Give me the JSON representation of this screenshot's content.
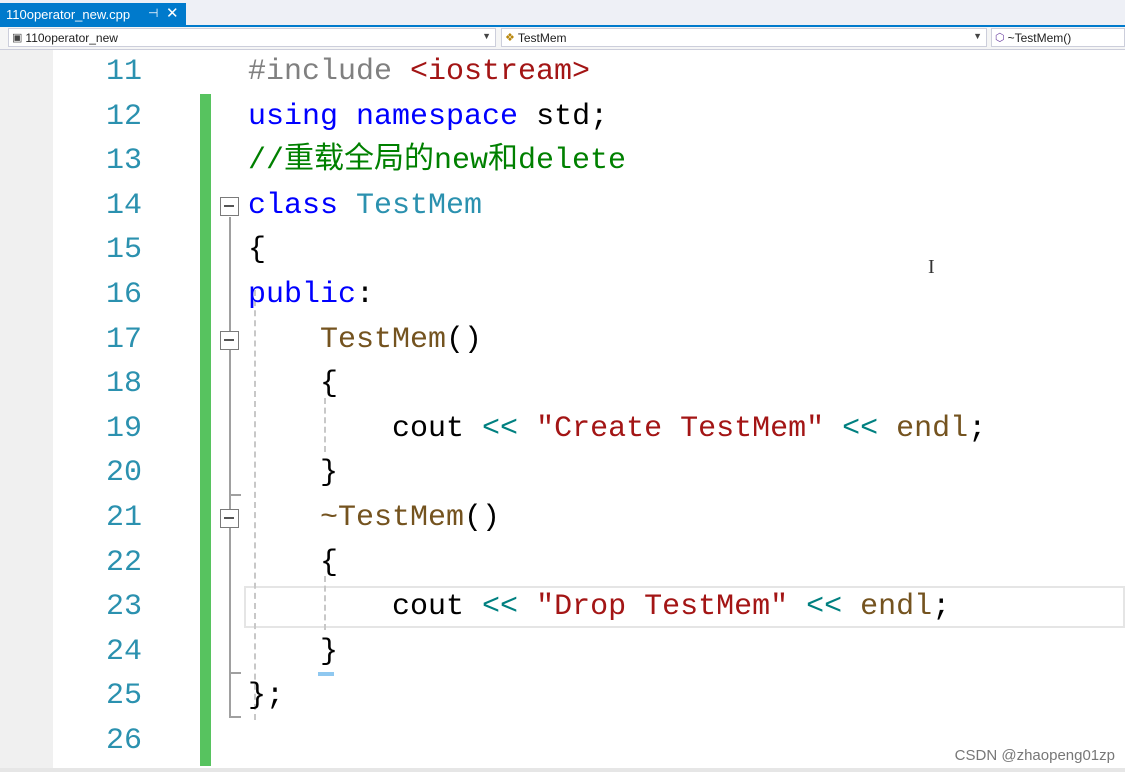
{
  "tab": {
    "filename": "110operator_new.cpp",
    "pin_glyph": "⊣",
    "close_glyph": "✕"
  },
  "navbar": {
    "project": "110operator_new",
    "class_scope": "TestMem",
    "member": "~TestMem()"
  },
  "editor": {
    "lines": [
      {
        "num": "11",
        "tokens": [
          {
            "t": "#include ",
            "c": "pp"
          },
          {
            "t": "<iostream>",
            "c": "st"
          }
        ]
      },
      {
        "num": "12",
        "tokens": [
          {
            "t": "using",
            "c": "kw"
          },
          {
            "t": " ",
            "c": ""
          },
          {
            "t": "namespace",
            "c": "kw"
          },
          {
            "t": " std;",
            "c": ""
          }
        ]
      },
      {
        "num": "13",
        "tokens": [
          {
            "t": "//重载全局的new和delete",
            "c": "cm"
          }
        ]
      },
      {
        "num": "14",
        "tokens": [
          {
            "t": "class",
            "c": "kw"
          },
          {
            "t": " ",
            "c": ""
          },
          {
            "t": "TestMem",
            "c": "ty"
          }
        ]
      },
      {
        "num": "15",
        "tokens": [
          {
            "t": "{",
            "c": ""
          }
        ]
      },
      {
        "num": "16",
        "tokens": [
          {
            "t": "public",
            "c": "kw"
          },
          {
            "t": ":",
            "c": ""
          }
        ]
      },
      {
        "num": "17",
        "tokens": [
          {
            "t": "    ",
            "c": ""
          },
          {
            "t": "TestMem",
            "c": "fn"
          },
          {
            "t": "()",
            "c": ""
          }
        ]
      },
      {
        "num": "18",
        "tokens": [
          {
            "t": "    {",
            "c": ""
          }
        ]
      },
      {
        "num": "19",
        "tokens": [
          {
            "t": "        cout ",
            "c": ""
          },
          {
            "t": "<<",
            "c": "op"
          },
          {
            "t": " ",
            "c": ""
          },
          {
            "t": "\"Create TestMem\"",
            "c": "st"
          },
          {
            "t": " ",
            "c": ""
          },
          {
            "t": "<<",
            "c": "op"
          },
          {
            "t": " ",
            "c": ""
          },
          {
            "t": "endl",
            "c": "fn"
          },
          {
            "t": ";",
            "c": ""
          }
        ]
      },
      {
        "num": "20",
        "tokens": [
          {
            "t": "    }",
            "c": ""
          }
        ]
      },
      {
        "num": "21",
        "tokens": [
          {
            "t": "    ",
            "c": ""
          },
          {
            "t": "~TestMem",
            "c": "fn"
          },
          {
            "t": "()",
            "c": ""
          }
        ]
      },
      {
        "num": "22",
        "tokens": [
          {
            "t": "    {",
            "c": ""
          }
        ]
      },
      {
        "num": "23",
        "tokens": [
          {
            "t": "        cout ",
            "c": ""
          },
          {
            "t": "<<",
            "c": "op"
          },
          {
            "t": " ",
            "c": ""
          },
          {
            "t": "\"Drop TestMem\"",
            "c": "st"
          },
          {
            "t": " ",
            "c": ""
          },
          {
            "t": "<<",
            "c": "op"
          },
          {
            "t": " ",
            "c": ""
          },
          {
            "t": "endl",
            "c": "fn"
          },
          {
            "t": ";",
            "c": ""
          }
        ]
      },
      {
        "num": "24",
        "tokens": [
          {
            "t": "    }",
            "c": ""
          }
        ]
      },
      {
        "num": "25",
        "tokens": [
          {
            "t": "};",
            "c": ""
          }
        ]
      },
      {
        "num": "26",
        "tokens": []
      }
    ]
  },
  "watermark": "CSDN @zhaopeng01zp"
}
